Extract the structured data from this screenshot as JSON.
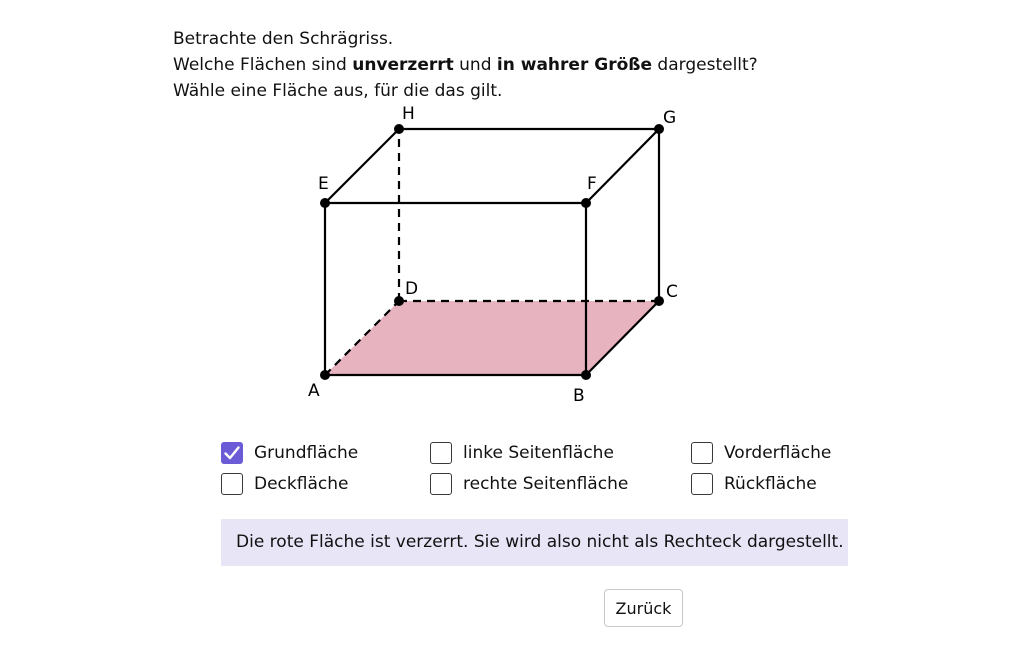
{
  "prompt": {
    "line1": "Betrachte den Schrägriss.",
    "line2_pre": "Welche Flächen sind ",
    "line2_bold1": "unverzerrt",
    "line2_mid": " und ",
    "line2_bold2": "in wahrer Größe",
    "line2_post": " dargestellt?",
    "line3": "Wähle eine Fläche aus, für die das gilt."
  },
  "figure": {
    "vertex_labels": {
      "A": "A",
      "B": "B",
      "C": "C",
      "D": "D",
      "E": "E",
      "F": "F",
      "G": "G",
      "H": "H"
    },
    "highlight_color": "#e6b3bf"
  },
  "options": [
    {
      "label": "Grundfläche",
      "checked": true
    },
    {
      "label": "linke Seitenfläche",
      "checked": false
    },
    {
      "label": "Vorderfläche",
      "checked": false
    },
    {
      "label": "Deckfläche",
      "checked": false
    },
    {
      "label": "rechte Seitenfläche",
      "checked": false
    },
    {
      "label": "Rückfläche",
      "checked": false
    }
  ],
  "feedback": "Die rote Fläche ist verzerrt. Sie wird also nicht als Rechteck dargestellt.",
  "back_button": "Zurück",
  "colors": {
    "accent": "#6b5bd6",
    "feedback_bg": "#e8e6f6"
  }
}
